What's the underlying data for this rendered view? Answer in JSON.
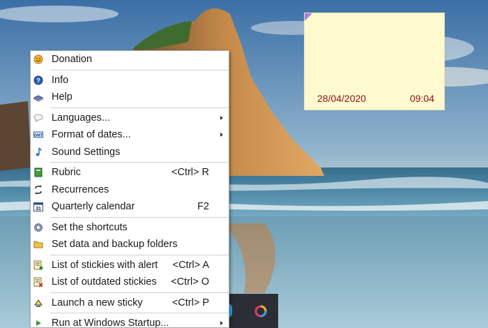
{
  "menu": {
    "items": [
      {
        "label": "Donation",
        "shortcut": "",
        "submenu": false,
        "icon": "smiley-icon"
      },
      {
        "label": "Info",
        "shortcut": "",
        "submenu": false,
        "icon": "info-icon"
      },
      {
        "label": "Help",
        "shortcut": "",
        "submenu": false,
        "icon": "help-book-icon"
      },
      {
        "label": "Languages...",
        "shortcut": "",
        "submenu": true,
        "icon": "speech-bubble-icon"
      },
      {
        "label": "Format of dates...",
        "shortcut": "",
        "submenu": true,
        "icon": "date-format-icon"
      },
      {
        "label": "Sound Settings",
        "shortcut": "",
        "submenu": false,
        "icon": "music-note-icon"
      },
      {
        "label": "Rubric",
        "shortcut": "<Ctrl> R",
        "submenu": false,
        "icon": "rubric-book-icon"
      },
      {
        "label": "Recurrences",
        "shortcut": "",
        "submenu": false,
        "icon": "recurrence-icon"
      },
      {
        "label": "Quarterly calendar",
        "shortcut": "F2",
        "submenu": false,
        "icon": "calendar-icon"
      },
      {
        "label": "Set the shortcuts",
        "shortcut": "",
        "submenu": false,
        "icon": "gear-icon"
      },
      {
        "label": "Set data and backup folders",
        "shortcut": "",
        "submenu": false,
        "icon": "folder-icon"
      },
      {
        "label": "List of stickies with alert",
        "shortcut": "<Ctrl> A",
        "submenu": false,
        "icon": "alert-list-icon"
      },
      {
        "label": "List of outdated stickies",
        "shortcut": "<Ctrl> O",
        "submenu": false,
        "icon": "outdated-list-icon"
      },
      {
        "label": "Launch a new sticky",
        "shortcut": "<Ctrl> P",
        "submenu": false,
        "icon": "new-sticky-icon"
      },
      {
        "label": "Run at Windows Startup...",
        "shortcut": "",
        "submenu": true,
        "icon": "play-arrow-icon"
      }
    ]
  },
  "sticky": {
    "date": "28/04/2020",
    "time": "09:04",
    "background_color": "#fff9cf",
    "text_color": "#8a1414",
    "corner_color": "#a882d8"
  }
}
